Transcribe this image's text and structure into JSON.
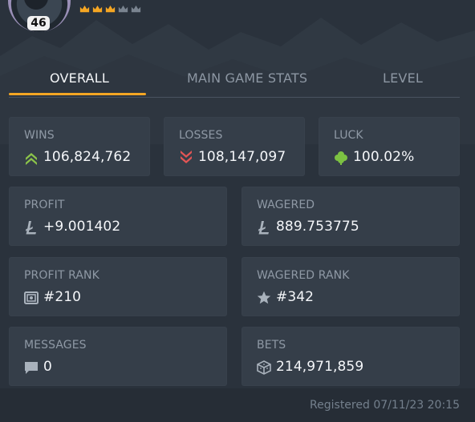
{
  "profile": {
    "level": "46",
    "crowns_filled": 3,
    "crowns_total": 5
  },
  "tabs": [
    {
      "label": "OVERALL",
      "active": true
    },
    {
      "label": "MAIN GAME STATS",
      "active": false
    },
    {
      "label": "LEVEL",
      "active": false
    }
  ],
  "stats": {
    "wins": {
      "label": "WINS",
      "value": "106,824,762",
      "icon": "double-chevron-up-icon"
    },
    "losses": {
      "label": "LOSSES",
      "value": "108,147,097",
      "icon": "double-chevron-down-icon"
    },
    "luck": {
      "label": "LUCK",
      "value": "100.02%",
      "icon": "clover-icon"
    },
    "profit": {
      "label": "PROFIT",
      "value": "+9.001402",
      "icon": "litecoin-icon"
    },
    "wagered": {
      "label": "WAGERED",
      "value": "889.753775",
      "icon": "litecoin-icon"
    },
    "profit_rank": {
      "label": "PROFIT RANK",
      "value": "#210",
      "icon": "safe-icon"
    },
    "wagered_rank": {
      "label": "WAGERED RANK",
      "value": "#342",
      "icon": "star-icon"
    },
    "messages": {
      "label": "MESSAGES",
      "value": "0",
      "icon": "chat-bubble-icon"
    },
    "bets": {
      "label": "BETS",
      "value": "214,971,859",
      "icon": "cube-icon"
    }
  },
  "footer": {
    "registered": "Registered 07/11/23 20:15"
  },
  "colors": {
    "accent": "#f5a623",
    "win": "#8bc34a",
    "loss": "#e25555",
    "clover": "#7cc142"
  }
}
